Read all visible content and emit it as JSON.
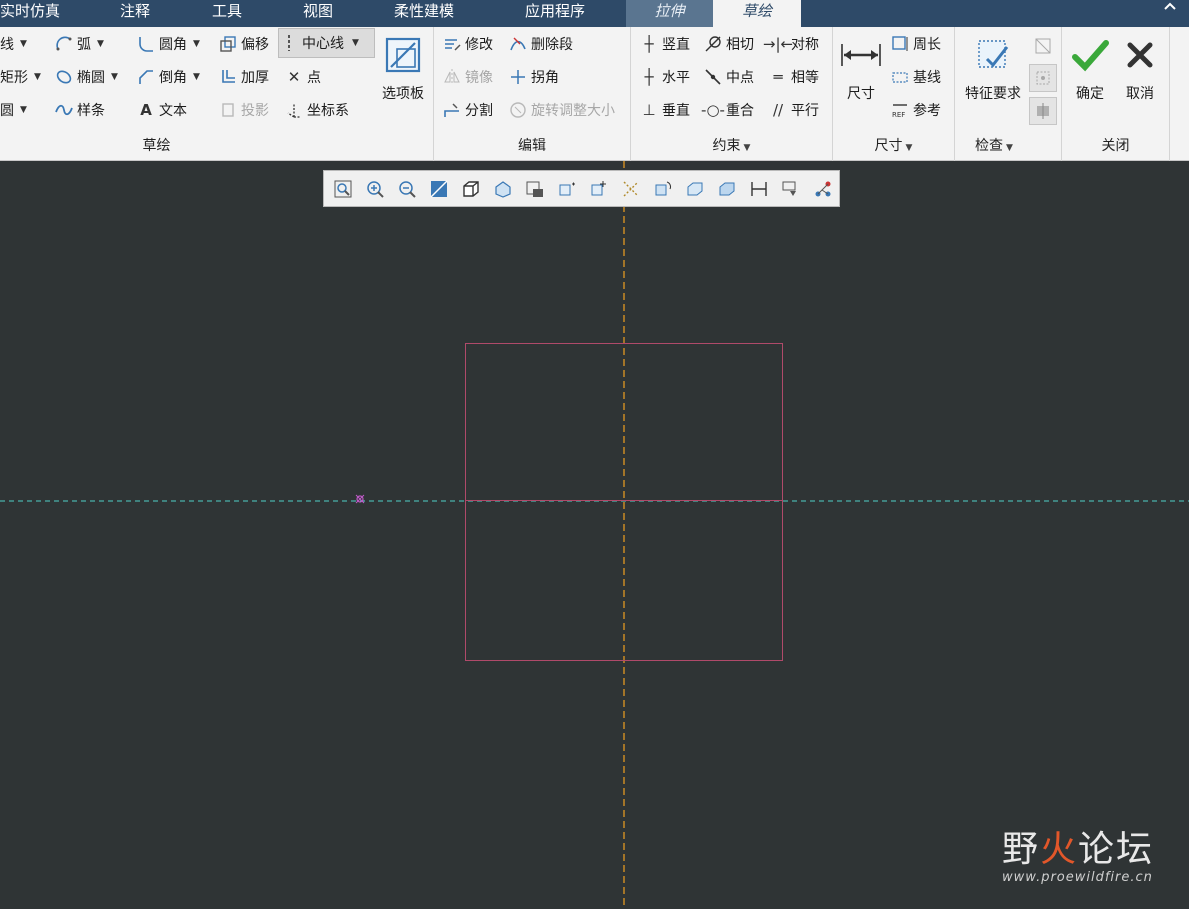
{
  "menubar": {
    "tabs": [
      {
        "label": "实时仿真"
      },
      {
        "label": "注释"
      },
      {
        "label": "工具"
      },
      {
        "label": "视图"
      },
      {
        "label": "柔性建模"
      },
      {
        "label": "应用程序"
      },
      {
        "label": "拉伸"
      },
      {
        "label": "草绘"
      }
    ],
    "collapse_icon": "chevron-up-icon"
  },
  "ribbon": {
    "sketch_group": {
      "label": "草绘",
      "tools": {
        "line": "线",
        "arc": "弧",
        "fillet": "圆角",
        "offset": "偏移",
        "centerline": "中心线",
        "rectangle": "矩形",
        "ellipse": "椭圆",
        "chamfer": "倒角",
        "thicken": "加厚",
        "point": "点",
        "circle": "圆",
        "spline": "样条",
        "text": "文本",
        "project": "投影",
        "coordsys": "坐标系"
      },
      "palette": "选项板"
    },
    "edit_group": {
      "label": "编辑",
      "tools": {
        "modify": "修改",
        "delete_segment": "删除段",
        "mirror": "镜像",
        "corner": "拐角",
        "divide": "分割",
        "rotate_resize": "旋转调整大小"
      }
    },
    "constrain_group": {
      "label": "约束",
      "tools": {
        "vertical": "竖直",
        "tangent": "相切",
        "symmetric": "对称",
        "horizontal": "水平",
        "midpoint": "中点",
        "equal": "相等",
        "perpendicular": "垂直",
        "coincident": "重合",
        "parallel": "平行"
      }
    },
    "dimension_group": {
      "label": "尺寸",
      "tools": {
        "dimension": "尺寸",
        "perimeter": "周长",
        "baseline": "基线",
        "reference": "参考"
      }
    },
    "inspect_group": {
      "label": "检查",
      "tools": {
        "feature_requirements": "特征要求"
      }
    },
    "close_group": {
      "label": "关闭",
      "tools": {
        "ok": "确定",
        "cancel": "取消"
      }
    }
  },
  "colors": {
    "menubar_bg": "#2e4a68",
    "canvas_bg": "#2f3435",
    "vertical_ref": "#f0a020",
    "horizontal_ref": "#4fd0c8",
    "rectangle": "#b04a6a",
    "ok_check": "#3aa83a"
  },
  "watermark": {
    "title_a": "野",
    "title_b": "火",
    "title_c": "论坛",
    "url": "www.proewildfire.cn"
  }
}
